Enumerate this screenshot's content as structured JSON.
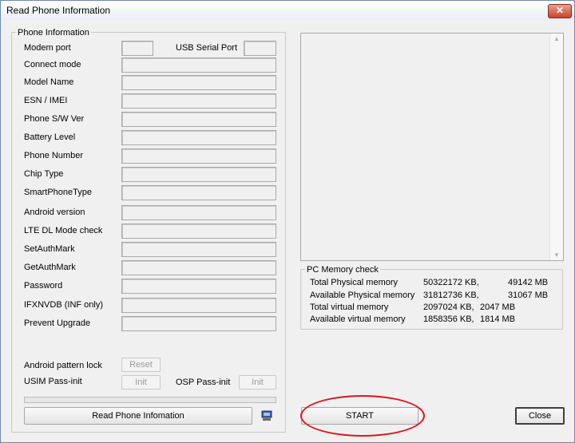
{
  "window": {
    "title": "Read Phone Information",
    "close_glyph": "✕"
  },
  "phone_info": {
    "group_title": "Phone Information",
    "modem_port_label": "Modem port",
    "usb_serial_port_label": "USB Serial Port",
    "fields": [
      {
        "label": "Connect mode",
        "value": ""
      },
      {
        "label": "Model Name",
        "value": ""
      },
      {
        "label": "ESN / IMEI",
        "value": ""
      },
      {
        "label": "Phone S/W Ver",
        "value": ""
      },
      {
        "label": "Battery Level",
        "value": ""
      },
      {
        "label": "Phone Number",
        "value": ""
      },
      {
        "label": "Chip Type",
        "value": ""
      },
      {
        "label": "SmartPhoneType",
        "value": ""
      },
      {
        "label": "Android version",
        "value": ""
      },
      {
        "label": "LTE DL Mode check",
        "value": ""
      },
      {
        "label": "SetAuthMark",
        "value": ""
      },
      {
        "label": "GetAuthMark",
        "value": ""
      },
      {
        "label": "Password",
        "value": ""
      },
      {
        "label": "IFXNVDB (INF only)",
        "value": ""
      },
      {
        "label": "Prevent Upgrade",
        "value": ""
      }
    ],
    "android_pattern_lock_label": "Android pattern lock",
    "reset_label": "Reset",
    "usim_pass_init_label": "USIM Pass-init",
    "init_label": "Init",
    "osp_pass_init_label": "OSP Pass-init",
    "osp_init_label": "Init",
    "read_button_label": "Read Phone Infomation"
  },
  "pc_memory": {
    "group_title": "PC Memory check",
    "rows": [
      {
        "label": "Total Physical memory",
        "kb": "50322172 KB,",
        "mb": "49142 MB"
      },
      {
        "label": "Available Physical memory",
        "kb": "31812736 KB,",
        "mb": "31067 MB"
      },
      {
        "label": "Total virtual memory",
        "kb": "2097024 KB,",
        "mb": "2047 MB"
      },
      {
        "label": "Available virtual memory",
        "kb": "1858356 KB,",
        "mb": "1814 MB"
      }
    ]
  },
  "actions": {
    "start_label": "START",
    "close_label": "Close"
  },
  "colors": {
    "highlight_ellipse": "#e0141b",
    "title_gradient_end": "#e9eef6"
  }
}
